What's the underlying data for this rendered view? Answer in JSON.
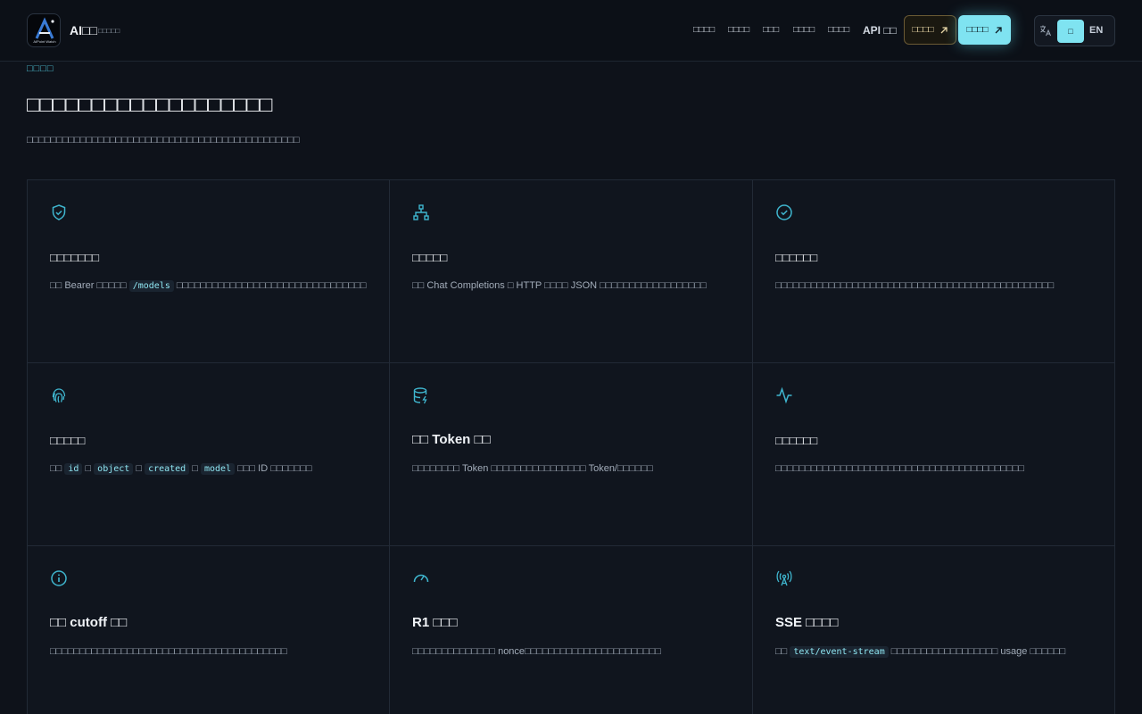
{
  "brand": {
    "name": "AI□□",
    "subtitle": "□□□□□",
    "logo_text": "AIPoint Watch"
  },
  "nav": {
    "items": [
      "□□□□",
      "□□□□",
      "□□□",
      "□□□□",
      "□□□□"
    ],
    "api_label": "API □□",
    "outline_button": "□□□□",
    "solid_button": "□□□□",
    "lang_cn": "□",
    "lang_en": "EN"
  },
  "hero": {
    "eyebrow": "□□□□",
    "title": "□□□□□□□□□□□□□□□□□□□",
    "description": "□□□□□□□□□□□□□□□□□□□□□□□□□□□□□□□□□□□□□□□□□□□□□□"
  },
  "cards": [
    {
      "icon": "shield-check-icon",
      "title": "□□□□□□□",
      "desc_parts": [
        {
          "t": "text",
          "v": "□□ Bearer □□□□□ "
        },
        {
          "t": "code",
          "v": "/models"
        },
        {
          "t": "text",
          "v": " □□□□□□□□□□□□□□□□□□□□□□□□□□□□□□□□"
        }
      ]
    },
    {
      "icon": "network-icon",
      "title": "□□□□□",
      "desc_parts": [
        {
          "t": "text",
          "v": "□□ Chat Completions □ HTTP □□□□ JSON □□□□□□□□□□□□□□□□□□"
        }
      ]
    },
    {
      "icon": "circle-check-icon",
      "title": "□□□□□□",
      "desc_parts": [
        {
          "t": "text",
          "v": "□□□□□□□□□□□□□□□□□□□□□□□□□□□□□□□□□□□□□□□□□□□□□□□"
        }
      ]
    },
    {
      "icon": "fingerprint-icon",
      "title": "□□□□□",
      "desc_parts": [
        {
          "t": "text",
          "v": "□□ "
        },
        {
          "t": "code",
          "v": "id"
        },
        {
          "t": "text",
          "v": " □ "
        },
        {
          "t": "code",
          "v": "object"
        },
        {
          "t": "text",
          "v": " □ "
        },
        {
          "t": "code",
          "v": "created"
        },
        {
          "t": "text",
          "v": " □ "
        },
        {
          "t": "code",
          "v": "model"
        },
        {
          "t": "text",
          "v": " □□□ ID □□□□□□□"
        }
      ]
    },
    {
      "icon": "database-zap-icon",
      "title": "□□ Token □□",
      "desc_parts": [
        {
          "t": "text",
          "v": "□□□□□□□□ Token □□□□□□□□□□□□□□□□ Token/□□□□□□"
        }
      ]
    },
    {
      "icon": "activity-icon",
      "title": "□□□□□□",
      "desc_parts": [
        {
          "t": "text",
          "v": "□□□□□□□□□□□□□□□□□□□□□□□□□□□□□□□□□□□□□□□□□□"
        }
      ]
    },
    {
      "icon": "info-icon",
      "title": "□□ cutoff □□",
      "desc_parts": [
        {
          "t": "text",
          "v": "□□□□□□□□□□□□□□□□□□□□□□□□□□□□□□□□□□□□□□□□"
        }
      ]
    },
    {
      "icon": "gauge-icon",
      "title": "R1 □□□",
      "desc_parts": [
        {
          "t": "text",
          "v": "□□□□□□□□□□□□□□ nonce□□□□□□□□□□□□□□□□□□□□□□□"
        }
      ]
    },
    {
      "icon": "radio-tower-icon",
      "title": "SSE □□□□",
      "desc_parts": [
        {
          "t": "text",
          "v": "□□ "
        },
        {
          "t": "code",
          "v": "text/event-stream"
        },
        {
          "t": "text",
          "v": " □□□□□□□□□□□□□□□□□□ usage □□□□□□"
        }
      ]
    }
  ]
}
